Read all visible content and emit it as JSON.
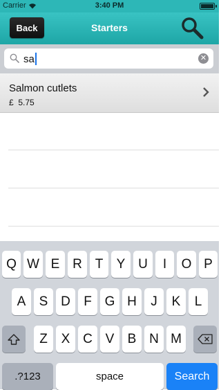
{
  "status": {
    "carrier": "Carrier",
    "time": "3:40 PM"
  },
  "nav": {
    "back_label": "Back",
    "title": "Starters"
  },
  "search": {
    "value": "sa"
  },
  "results": [
    {
      "name": "Salmon cutlets",
      "currency": "£",
      "price": "5.75"
    }
  ],
  "keyboard": {
    "row1": [
      "Q",
      "W",
      "E",
      "R",
      "T",
      "Y",
      "U",
      "I",
      "O",
      "P"
    ],
    "row2": [
      "A",
      "S",
      "D",
      "F",
      "G",
      "H",
      "J",
      "K",
      "L"
    ],
    "row3": [
      "Z",
      "X",
      "C",
      "V",
      "B",
      "N",
      "M"
    ],
    "numbers_label": ".?123",
    "space_label": "space",
    "search_label": "Search"
  },
  "colors": {
    "accent": "#2db7b7",
    "search_key": "#1a82f7"
  }
}
